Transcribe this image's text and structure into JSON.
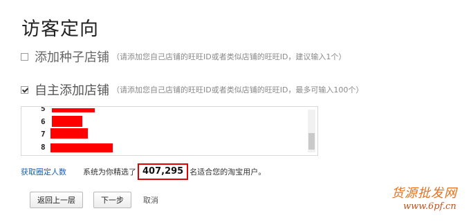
{
  "page": {
    "title": "访客定向"
  },
  "options": [
    {
      "label": "添加种子店铺",
      "hint": "（请添加您自己店铺的旺旺ID或者类似店铺的旺旺ID，建议输入1个）",
      "checked": false
    },
    {
      "label": "自主添加店铺",
      "hint": "（请添加您自己店铺的旺旺ID或者类似店铺的旺旺ID，最多可输入100个）",
      "checked": true
    }
  ],
  "shop_list": {
    "rows": [
      {
        "num": "5"
      },
      {
        "num": "6"
      },
      {
        "num": "7"
      },
      {
        "num": "8"
      }
    ],
    "redaction_color": "#ff0000"
  },
  "stats": {
    "link": "获取圈定人数",
    "prefix": "系统为你精选了",
    "count": "407,295",
    "suffix": "名适合您的淘宝用户。"
  },
  "actions": {
    "back": "返回上一层",
    "next": "下一步",
    "cancel": "取消"
  },
  "watermark": {
    "text": "货源批发网",
    "url": "www.6pf.cn"
  },
  "colors": {
    "accent_link": "#1a5db5",
    "highlight_border": "#e00000",
    "watermark": "#e8701a"
  }
}
